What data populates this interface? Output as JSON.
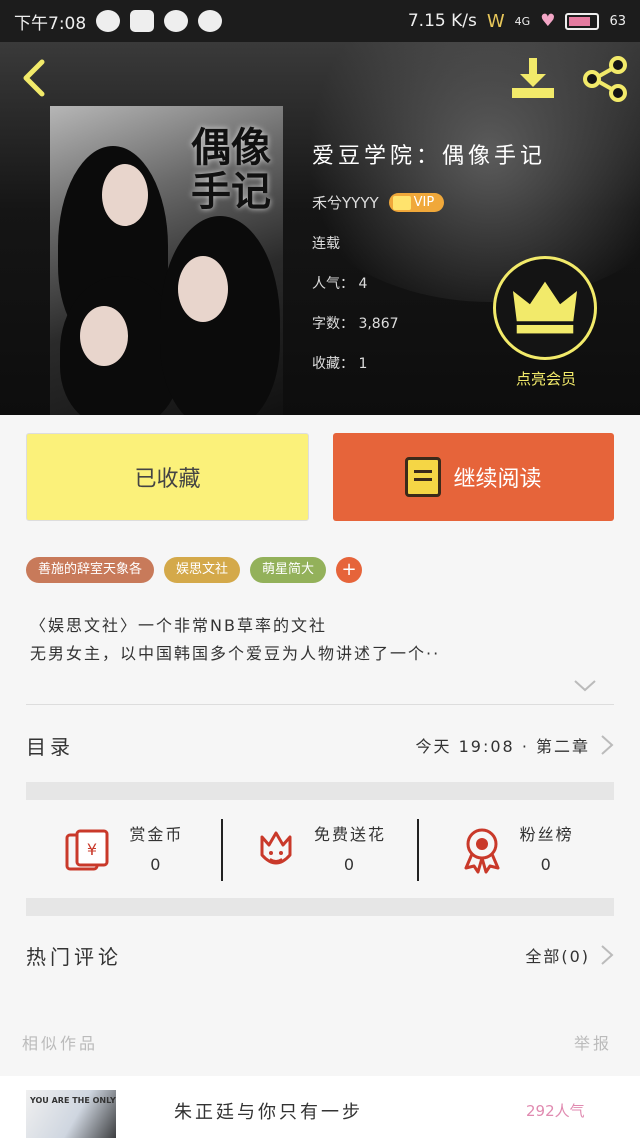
{
  "status_bar": {
    "time": "下午7:08",
    "net_speed": "7.15 K/s",
    "signal": "4G",
    "battery": "63"
  },
  "header": {
    "cover_title": "偶像手记",
    "book_title": "爱豆学院：偶像手记",
    "author": "禾兮YYYY",
    "vip": "VIP",
    "status": "连载",
    "popularity": "人气： 4",
    "word_count": "字数： 3,867",
    "favorites": "收藏： 1",
    "member_label": "点亮会员"
  },
  "actions": {
    "collected": "已收藏",
    "continue": "继续阅读"
  },
  "tags": [
    {
      "label": "善施的辞室天象各",
      "color": "#c87a5a"
    },
    {
      "label": "娱思文社",
      "color": "#d4a94a"
    },
    {
      "label": "萌星简大",
      "color": "#93b15a"
    },
    {
      "label": "+",
      "color": "#e6643a"
    }
  ],
  "description": {
    "line1": "〈娱思文社〉一个非常NB草率的文社",
    "line2": "无男女主，以中国韩国多个爱豆为人物讲述了一个··"
  },
  "toc": {
    "label": "目录",
    "latest": "今天 19:08 · 第二章"
  },
  "rewards": [
    {
      "label": "赏金币",
      "count": "0"
    },
    {
      "label": "免费送花",
      "count": "0"
    },
    {
      "label": "粉丝榜",
      "count": "0"
    }
  ],
  "comments": {
    "label": "热门评论",
    "all": "全部(0)"
  },
  "related": {
    "label": "相似作品",
    "report": "举报",
    "book_title": "朱正廷与你只有一步",
    "cover_text": "YOU ARE THE ONLY",
    "popularity": "292人气"
  }
}
